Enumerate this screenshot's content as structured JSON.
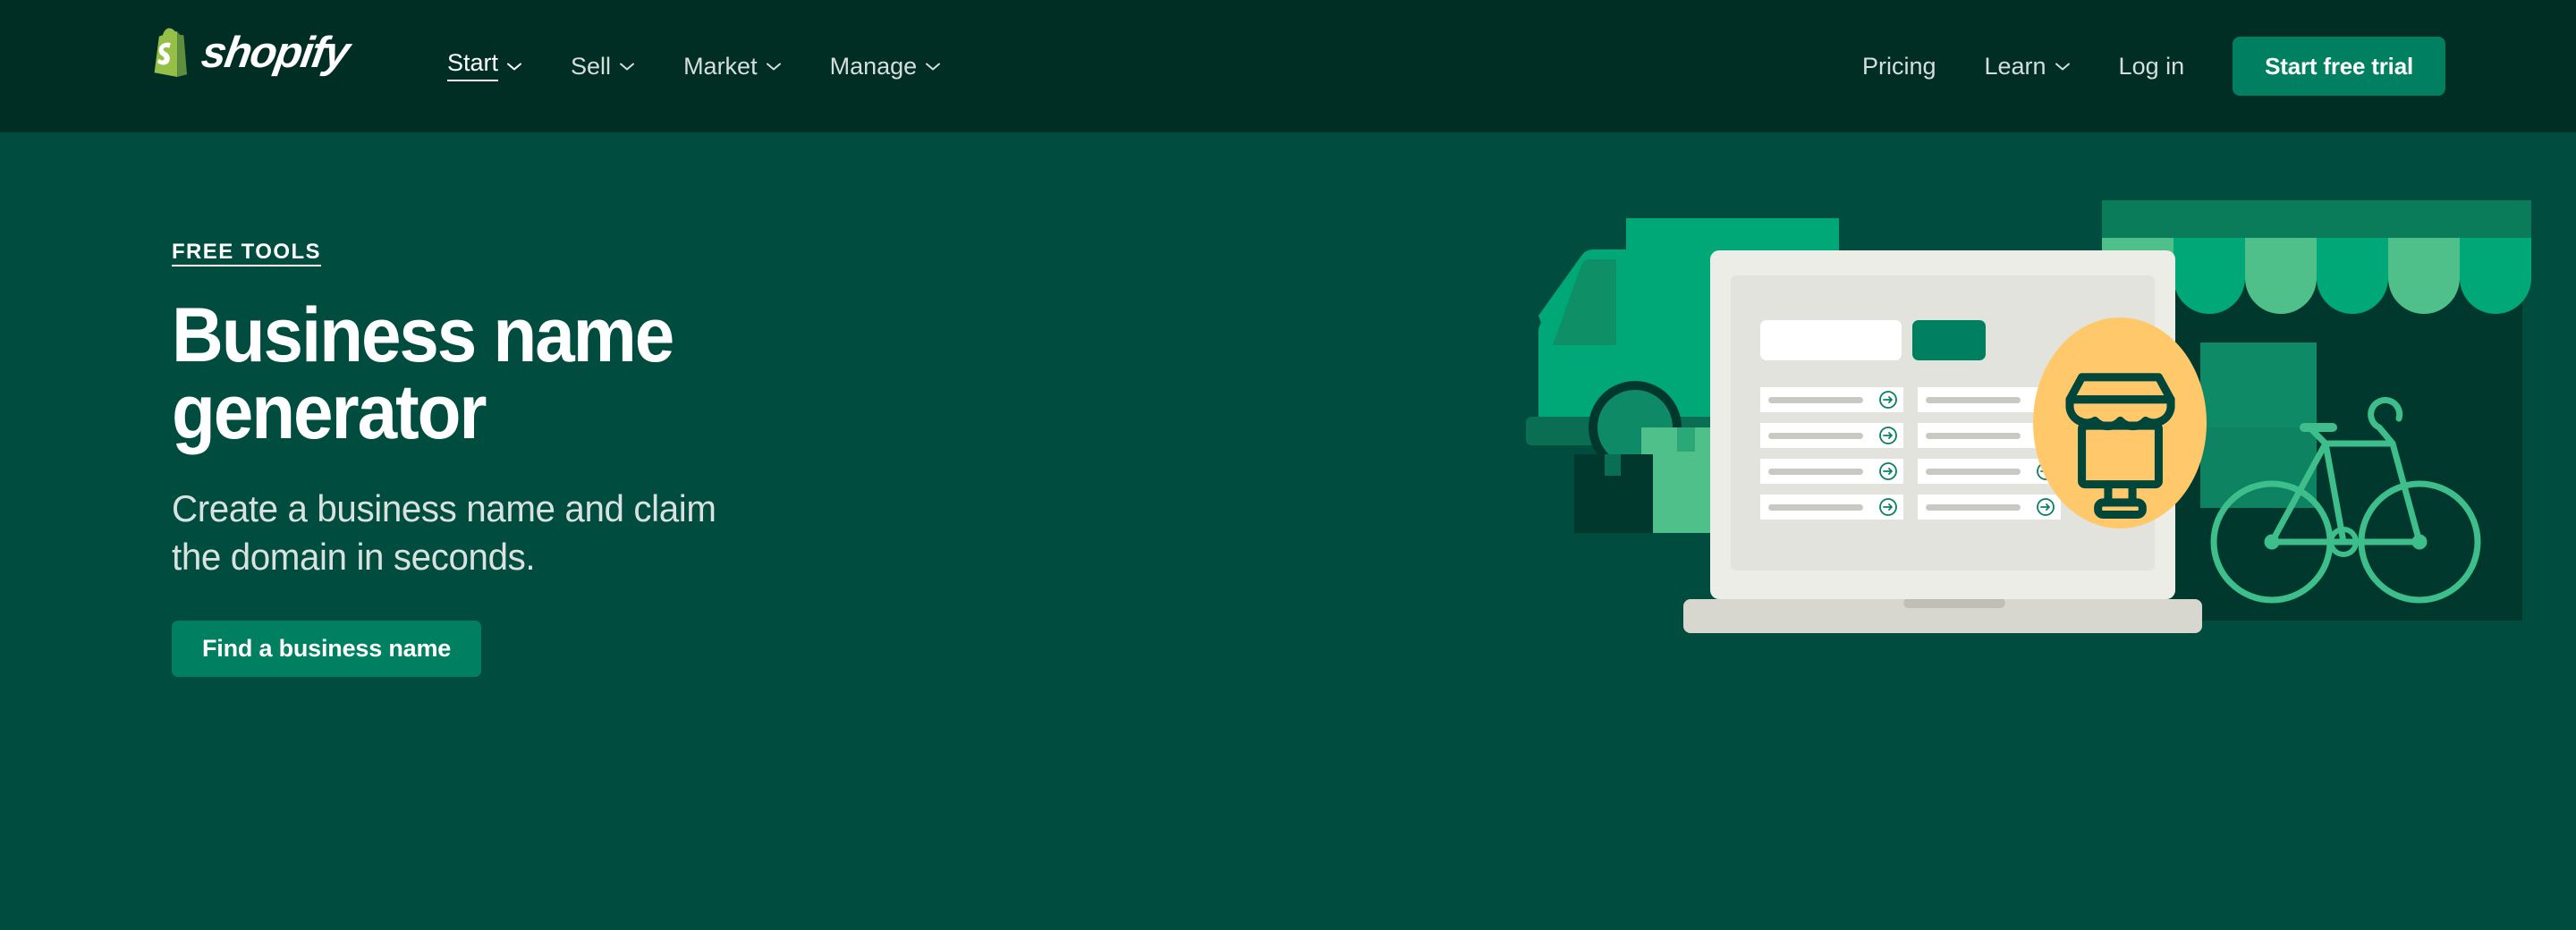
{
  "brand": {
    "name": "shopify",
    "logo_icon": "shopify-bag-icon",
    "logo_color": "#95BF47",
    "logo_shadow_color": "#5E8E3E"
  },
  "colors": {
    "header_bg": "#002E25",
    "hero_bg": "#004C3F",
    "accent_green": "#008060",
    "text_primary": "#FFFFFF",
    "text_muted": "#D6DEDB",
    "illustration_yellow": "#FFC96B",
    "illustration_green_light": "#4FC08A",
    "illustration_green_mid": "#00A878",
    "illustration_green_dark": "#00382D",
    "laptop_body": "#EDEDE8",
    "laptop_screen": "#E3E3DE"
  },
  "header": {
    "nav_left": [
      {
        "label": "Start",
        "has_caret": true,
        "active": true,
        "caret_icon": "chevron-down-icon"
      },
      {
        "label": "Sell",
        "has_caret": true,
        "active": false,
        "caret_icon": "chevron-down-icon"
      },
      {
        "label": "Market",
        "has_caret": true,
        "active": false,
        "caret_icon": "chevron-down-icon"
      },
      {
        "label": "Manage",
        "has_caret": true,
        "active": false,
        "caret_icon": "chevron-down-icon"
      }
    ],
    "nav_right": [
      {
        "label": "Pricing",
        "has_caret": false,
        "caret_icon": ""
      },
      {
        "label": "Learn",
        "has_caret": true,
        "caret_icon": "chevron-down-icon"
      },
      {
        "label": "Log in",
        "has_caret": false,
        "caret_icon": ""
      }
    ],
    "cta_label": "Start free trial"
  },
  "hero": {
    "eyebrow": "FREE TOOLS",
    "title_line_1": "Business name",
    "title_line_2": "generator",
    "subtitle_line_1": "Create a business name and claim",
    "subtitle_line_2": "the domain in seconds.",
    "button_label": "Find a business name"
  },
  "illustration": {
    "name": "ecommerce-hero-illustration",
    "elements": [
      "delivery-truck",
      "shipping-boxes",
      "laptop-with-name-results",
      "storefront-building",
      "bicycle",
      "storefront-badge-icon"
    ],
    "laptop_screen": {
      "search_field": "",
      "search_button": "",
      "result_rows": 4,
      "result_columns": 2,
      "row_icon": "arrow-right-circle-icon"
    },
    "badge_icon": "storefront-icon"
  }
}
